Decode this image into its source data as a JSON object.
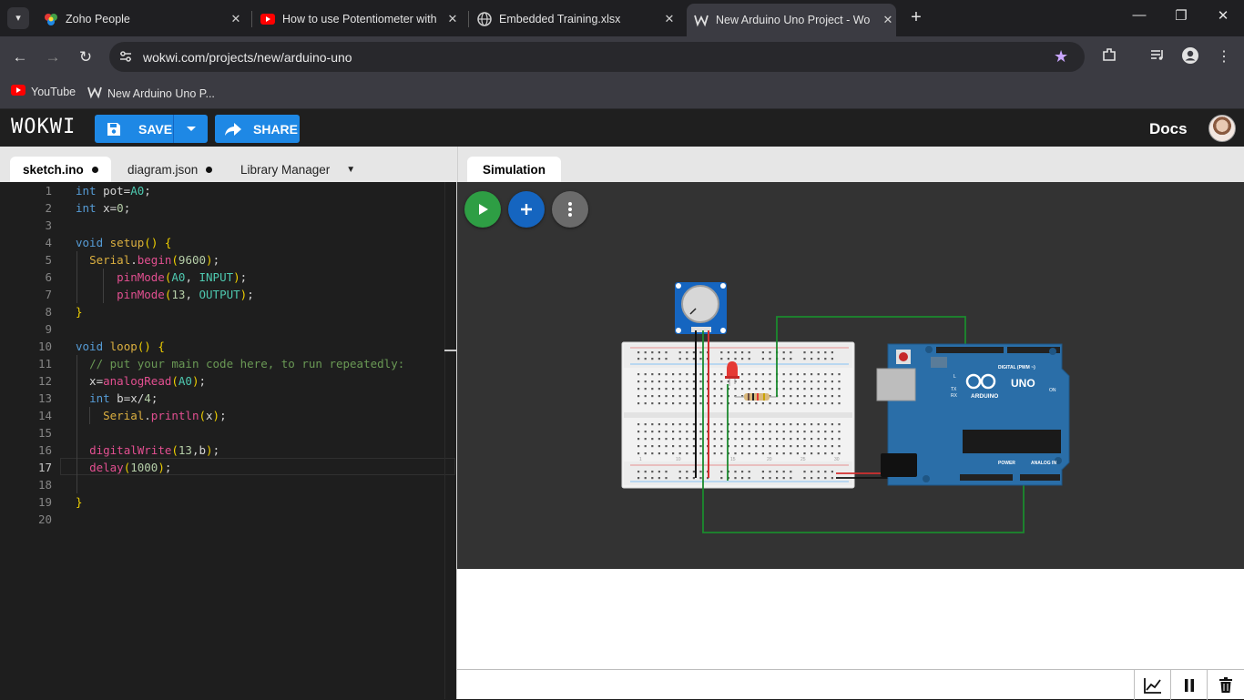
{
  "browser": {
    "tabs": [
      {
        "title": "Zoho People",
        "icon": "zoho-icon"
      },
      {
        "title": "How to use Potentiometer with",
        "icon": "youtube-icon"
      },
      {
        "title": "Embedded Training.xlsx",
        "icon": "globe-icon"
      },
      {
        "title": "New Arduino Uno Project - Wo",
        "icon": "wokwi-icon",
        "active": true
      }
    ],
    "url": "wokwi.com/projects/new/arduino-uno",
    "bookmarks": [
      {
        "label": "YouTube",
        "icon": "youtube-icon"
      },
      {
        "label": "New Arduino Uno P...",
        "icon": "wokwi-icon"
      }
    ]
  },
  "wokwi": {
    "logo": "WOKWI",
    "save_label": "SAVE",
    "share_label": "SHARE",
    "docs_label": "Docs",
    "colors": {
      "accent": "#1e88e5",
      "play": "#2e9e44"
    }
  },
  "editor": {
    "tabs": [
      {
        "label": "sketch.ino",
        "unsaved": true,
        "active": true
      },
      {
        "label": "diagram.json",
        "unsaved": true
      },
      {
        "label": "Library Manager"
      }
    ],
    "current_line": 17,
    "line_numbers": [
      "1",
      "2",
      "3",
      "4",
      "5",
      "6",
      "7",
      "8",
      "9",
      "10",
      "11",
      "12",
      "13",
      "14",
      "15",
      "16",
      "17",
      "18",
      "19",
      "20"
    ],
    "lines": [
      "int pot=A0;",
      "int x=0;",
      "",
      "void setup() {",
      "  Serial.begin(9600);",
      "      pinMode(A0, INPUT);",
      "      pinMode(13, OUTPUT);",
      "}",
      "",
      "void loop() {",
      "  // put your main code here, to run repeatedly:",
      "  x=analogRead(A0);",
      "  int b=x/4;",
      "    Serial.println(x);",
      "",
      "  digitalWrite(13,b);",
      "  delay(1000);",
      "",
      "}",
      ""
    ]
  },
  "simulation": {
    "tab_label": "Simulation",
    "board_labels": {
      "board": "UNO",
      "brand": "ARDUINO",
      "digital": "DIGITAL (PWM ~)",
      "analog": "ANALOG IN",
      "power": "POWER",
      "on": "ON",
      "tx": "TX",
      "rx": "RX",
      "l": "L"
    },
    "breadboard_numbers": [
      "1",
      "5",
      "10",
      "15",
      "20",
      "25",
      "30"
    ]
  }
}
